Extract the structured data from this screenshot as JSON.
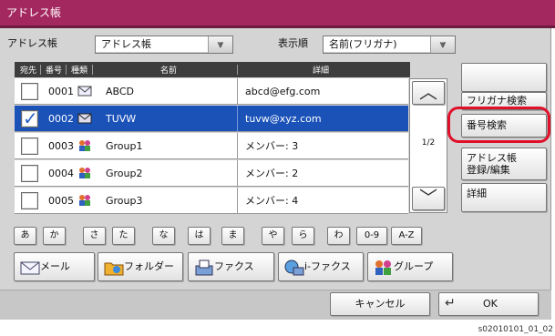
{
  "window": {
    "title": "アドレス帳"
  },
  "toolbar": {
    "book_label": "アドレス帳",
    "book_value": "アドレス帳",
    "sort_label": "表示順",
    "sort_value": "名前(フリガナ)"
  },
  "list": {
    "headers": {
      "dest": "宛先",
      "number": "番号",
      "type": "種類",
      "name": "名前",
      "detail": "詳細"
    },
    "rows": [
      {
        "number": "0001",
        "type_icon": "mail-icon",
        "name": "ABCD",
        "detail": "abcd@efg.com",
        "checked": false,
        "selected": false
      },
      {
        "number": "0002",
        "type_icon": "mail-icon",
        "name": "TUVW",
        "detail": "tuvw@xyz.com",
        "checked": true,
        "selected": true
      },
      {
        "number": "0003",
        "type_icon": "group-icon",
        "name": "Group1",
        "detail": "メンバー:  3",
        "checked": false,
        "selected": false
      },
      {
        "number": "0004",
        "type_icon": "group-icon",
        "name": "Group2",
        "detail": "メンバー:  2",
        "checked": false,
        "selected": false
      },
      {
        "number": "0005",
        "type_icon": "group-icon",
        "name": "Group3",
        "detail": "メンバー:  4",
        "checked": false,
        "selected": false
      }
    ],
    "page": "1/2"
  },
  "side": {
    "furigana_search": "フリガナ検索",
    "number_search": "番号検索",
    "register_edit": "アドレス帳\n登録/編集",
    "detail": "詳細"
  },
  "kana": [
    "あ",
    "か",
    "さ",
    "た",
    "な",
    "は",
    "ま",
    "や",
    "ら",
    "わ",
    "0-9",
    "A-Z"
  ],
  "categories": [
    {
      "label": "メール",
      "icon": "mail-icon"
    },
    {
      "label": "フォルダー",
      "icon": "folder-icon"
    },
    {
      "label": "ファクス",
      "icon": "fax-icon"
    },
    {
      "label": "i-ファクス",
      "icon": "ifax-icon"
    },
    {
      "label": "グループ",
      "icon": "group-icon"
    }
  ],
  "footer": {
    "cancel": "キャンセル",
    "ok": "OK"
  },
  "caption": "s02010101_01_02"
}
